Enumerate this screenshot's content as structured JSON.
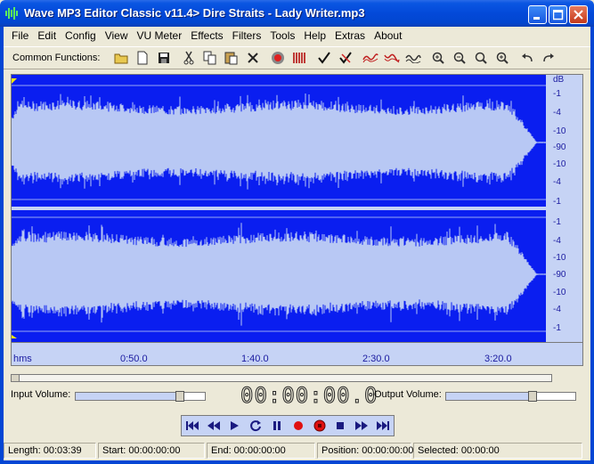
{
  "window": {
    "title": "Wave MP3 Editor Classic v11.4> Dire Straits - Lady Writer.mp3"
  },
  "menu": [
    "File",
    "Edit",
    "Config",
    "View",
    "VU Meter",
    "Effects",
    "Filters",
    "Tools",
    "Help",
    "Extras",
    "About"
  ],
  "toolbar": {
    "label": "Common Functions:",
    "icons": [
      "open-folder-icon",
      "new-file-icon",
      "save-icon",
      "cut-icon",
      "copy-icon",
      "paste-icon",
      "delete-icon",
      "record-icon",
      "marker-icon",
      "check-icon",
      "uncheck-icon",
      "wave-fade-in-icon",
      "wave-fade-out-icon",
      "wave-normalize-icon",
      "zoom-in-icon",
      "zoom-out-icon",
      "zoom-fit-icon",
      "zoom-select-icon",
      "undo-icon",
      "redo-icon"
    ]
  },
  "waveform": {
    "db_unit": "dB",
    "db_labels_top": [
      "-1",
      "-4",
      "-10",
      "-90",
      "-10",
      "-4",
      "-1"
    ],
    "db_labels_bottom": [
      "-1",
      "-4",
      "-10",
      "-90",
      "-10",
      "-4",
      "-1"
    ],
    "time_unit": "hms",
    "time_labels": [
      "0:50.0",
      "1:40.0",
      "2:30.0",
      "3:20.0"
    ],
    "colors": {
      "background": "#0a1ef0",
      "wave": "#b8c8f4",
      "panel": "#c6d3f5"
    }
  },
  "input_volume": {
    "label": "Input Volume:",
    "level": 0.83
  },
  "output_volume": {
    "label": "Output Volume:",
    "level": 0.68
  },
  "time_display": "00:00:00.0",
  "transport": [
    "skip-start-icon",
    "rewind-icon",
    "play-icon",
    "loop-icon",
    "pause-icon",
    "record-icon",
    "record-stop-icon",
    "stop-icon",
    "fast-forward-icon",
    "skip-end-icon"
  ],
  "status": {
    "length": "Length: 00:03:39",
    "start": "Start: 00:00:00:00",
    "end": "End: 00:00:00:00",
    "position": "Position: 00:00:00:00",
    "selected": "Selected: 00:00:00"
  }
}
